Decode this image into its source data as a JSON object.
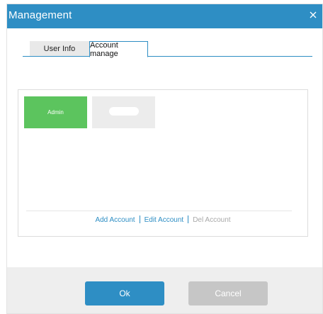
{
  "dialog": {
    "title": "Management",
    "close_icon": "close-icon"
  },
  "tabs": [
    {
      "label": "User Info",
      "active": false
    },
    {
      "label": "Account manage",
      "active": true
    }
  ],
  "accounts": [
    {
      "label": "Admin",
      "selected": true
    },
    {
      "label": "",
      "selected": false
    }
  ],
  "actions": {
    "add": "Add Account",
    "edit": "Edit Account",
    "del": "Del Account",
    "separator": "|"
  },
  "footer": {
    "ok_label": "Ok",
    "cancel_label": "Cancel"
  },
  "colors": {
    "accent": "#2e8ec4",
    "selected_tile": "#5cc45e",
    "disabled_text": "#a8a8a8"
  }
}
